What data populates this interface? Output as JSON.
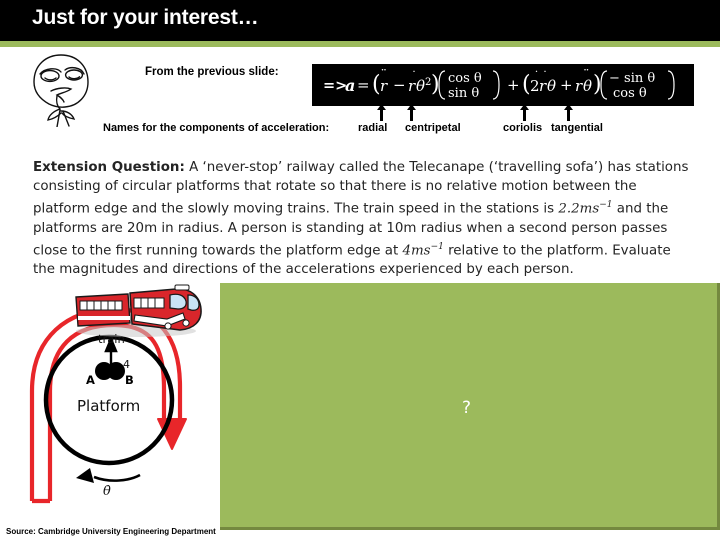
{
  "header": {
    "title": "Just for your interest…",
    "accent_color": "#9cba5c",
    "bar_color": "#000000"
  },
  "intro": {
    "face_icon": "rage-face-icon",
    "prev_slide_label": "From the previous slide:"
  },
  "equation": {
    "lead": "=> a =",
    "radial_group": "(r̈ − rθ̇²)",
    "radial_vector": [
      "cos θ",
      "sin θ"
    ],
    "plus": "+",
    "tangential_group": "(2ṙθ̇ + rθ̈)",
    "tangential_vector": [
      "− sin θ",
      "cos θ"
    ],
    "full_text": "=> a = (r̈ − rθ̇²)(cos θ, sin θ) + (2ṙθ̇ + rθ̈)(− sin θ, cos θ)"
  },
  "components": {
    "intro_label": "Names  for the components of acceleration:",
    "labels": [
      "radial",
      "centripetal",
      "coriolis",
      "tangential"
    ]
  },
  "question": {
    "lead_bold": "Extension Question",
    "colon": ":",
    "line1_a": " A ‘never-stop’ railway called the Telecanape (‘travelling sofa’) has stations consisting of circular platforms  that rotate so that there is no relative motion between the platform edge and the slowly moving trains. The train speed in the stations is ",
    "speed_train": "2.2ms",
    "speed_train_exp": "−1",
    "line1_b": " and the platforms are 20m in radius. A person is standing at 10m radius when a second person passes close to the first running towards the platform edge at ",
    "speed_person": "4ms",
    "speed_person_exp": "−1",
    "line1_c": " relative to the platform. Evaluate the magnitudes and directions of the accelerations experienced by each person."
  },
  "diagram": {
    "train_label": "train",
    "speed_label": "4",
    "point_a": "A",
    "point_b": "B",
    "platform_label": "Platform",
    "rotation_label": "θ̇",
    "track_color": "#e8262a",
    "platform_color": "#000000",
    "train_body_color": "#d9262b"
  },
  "answer_panel": {
    "placeholder": "?",
    "fill_color": "#9cba5c",
    "shadow_color": "#74893f"
  },
  "footer": {
    "source": "Source: Cambridge University Engineering Department"
  }
}
